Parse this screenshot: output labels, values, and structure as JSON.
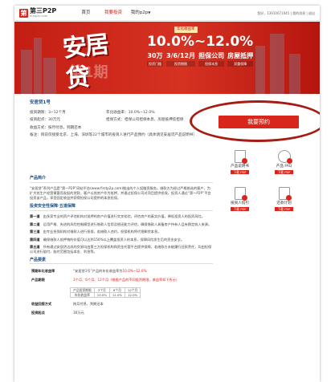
{
  "header": {
    "logo_mark": "第",
    "logo_name": "第三P2P",
    "logo_url": "firstp2p.com",
    "nav": [
      {
        "label": "首页"
      },
      {
        "label": "我要投资"
      },
      {
        "label": "我的p2p"
      }
    ],
    "nav_arrow": "▼",
    "user": "您好，13910071045 | 我的消息 | 退出"
  },
  "banner": {
    "big": "安居贷",
    "sub": "第1期",
    "label": "年化收益率",
    "rate": "10.0%~12.0%",
    "features": [
      {
        "top": "30万",
        "bot": "投资门槛"
      },
      {
        "top": "3/6/12月",
        "bot": "投资期限"
      },
      {
        "top": "担保公司",
        "bot": "担保本息"
      },
      {
        "top": "房屋抵押",
        "bot": "双重保障"
      }
    ],
    "colors": {
      "primary": "#c41e14",
      "accent": "#ffe9a8"
    }
  },
  "product": {
    "name": "安居贷1号",
    "info": [
      [
        "投资期限：3~12个月",
        "年化收益率：10.0%~12.0%"
      ],
      [
        "投资起点：30万元",
        "担保方式：担保公司担保本息，房屋抵押反担保"
      ],
      [
        "收益方式：按月付息，到期还本",
        ""
      ],
      [
        "备注：目前仅接受北京、上海、深圳等22个城市的投资人进行产品预约（具体请见安居贷产品说明书）",
        ""
      ]
    ]
  },
  "cta": {
    "label": "我要预约"
  },
  "docs": [
    {
      "name": "产品说明书",
      "dl": "下载 PDF",
      "icon": "document-icon"
    },
    {
      "name": "产品 FAQ",
      "dl": "下载 PDF",
      "icon": "faq-icon"
    },
    {
      "name": "投资人指引",
      "dl": "下载 PDF",
      "icon": "guide-icon"
    },
    {
      "name": "还款计划",
      "dl": "下载 PDF",
      "icon": "schedule-icon"
    }
  ],
  "content": {
    "sec1": "产品简介",
    "intro": "“安居贷”系列产品是“第一P2P”网站平台(www.firstp2p.com)推出的个人投融资服务。借款方为经过严格挑选的客户，为扩大其生产经营需要而发起的贷款，客户以其房产作为抵押，并通过担保公司对项目提供担保。投资人通过“第一P2P”平台投资该产品，享受固定收益并获得担保公司提供的本息担保。",
    "sec2": "投资安全性保障·五道保障",
    "steps": [
      {
        "k": "第一道",
        "v": "由多家专业的资产评估机构对抵押的房产价值进行交叉检验，评估房产的真实价值，降低投资人的投资风险。"
      },
      {
        "k": "第二道",
        "v": "运用严格、先进的风险控制模型进行借款人信用及偿还能力评估，确保借款人具备房产持有人且有稳定收入来源。"
      },
      {
        "k": "第三道",
        "v": "由专业担保机构对借款人进行担保，若借款人违约，担保机构将代偿剩余本息。"
      },
      {
        "k": "第四道",
        "v": "确保借款人抵押物的价值可以达到150%以上覆盖投资人的本息，保障风险发生后的资金安全。"
      },
      {
        "k": "第五道",
        "v": "所有通过安居贷达成的交易均由第三方担保机构和资金托管平台提供保障，若借款方未能履行还款责任，均由担保公司进行赔付，赔付范围包括本金、利息等。"
      }
    ],
    "sec3": "产品要素",
    "features": [
      {
        "k": "预期年化收益率",
        "v": "“安居贷1号”产品的年化收益率为",
        "red": "10.0%~12.0%"
      },
      {
        "k": "产品期限",
        "v": "",
        "red": "3个月、6个月、12个月（根据产品的不同投资期限，收益率如下所示）"
      }
    ],
    "mini_table": [
      [
        "产品投资期限",
        "3个月",
        "6个月",
        "12个月"
      ],
      [
        "年化收益率",
        "10.0%",
        "11.0%",
        "12.0%"
      ]
    ],
    "features2": [
      {
        "k": "收益回报方式",
        "v": "按月付息，到期还本"
      },
      {
        "k": "投资起点",
        "v": "30万元"
      }
    ]
  }
}
